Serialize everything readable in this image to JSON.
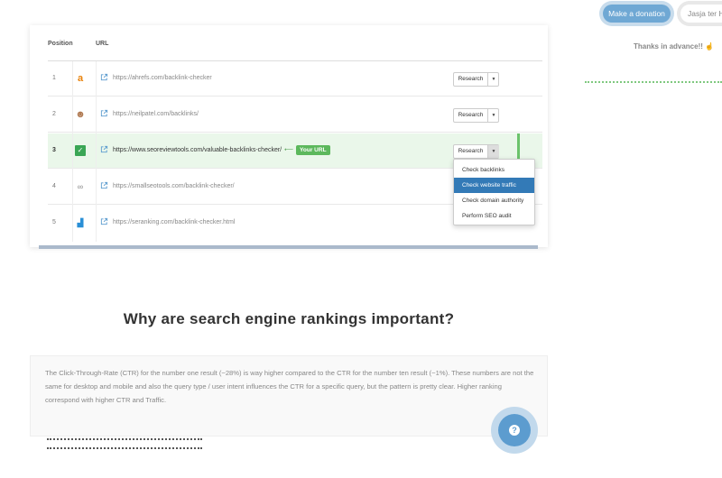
{
  "header": {
    "donate_label": "Make a donation",
    "author_label": "Jasja ter H",
    "thanks_text": "Thanks in advance!!",
    "thanks_icon": "thumbs-up-icon"
  },
  "table": {
    "columns": [
      "Position",
      "URL"
    ],
    "research_label": "Research",
    "your_url_label": "Your URL",
    "rows": [
      {
        "position": "1",
        "favicon": "a",
        "url": "https://ahrefs.com/backlink-checker"
      },
      {
        "position": "2",
        "favicon": "☻",
        "url": "https://neilpatel.com/backlinks/"
      },
      {
        "position": "3",
        "favicon": "✓",
        "url": "https://www.seoreviewtools.com/valuable-backlinks-checker/"
      },
      {
        "position": "4",
        "favicon": "∞",
        "url": "https://smallseotools.com/backlink-checker/"
      },
      {
        "position": "5",
        "favicon": "▟",
        "url": "https://seranking.com/backlink-checker.html"
      }
    ],
    "dropdown_items": [
      "Check backlinks",
      "Check website traffic",
      "Check domain authority",
      "Perform SEO audit"
    ]
  },
  "section": {
    "heading": "Why are search engine rankings important?",
    "body": "The Click-Through-Rate (CTR) for the number one result (~28%) is way higher compared to the CTR for the number ten result (~1%). These numbers are not the same for desktop and mobile and also the query type / user intent influences the CTR for a specific query, but the pattern is pretty clear. Higher ranking correspond with higher CTR and Traffic."
  },
  "help": {
    "icon": "question-icon",
    "glyph": "?"
  },
  "colors": {
    "accent": "#5c9ccf",
    "highlight": "#eaf7ea",
    "your_url_green": "#5cb85c",
    "dropdown_active": "#337ab7"
  }
}
